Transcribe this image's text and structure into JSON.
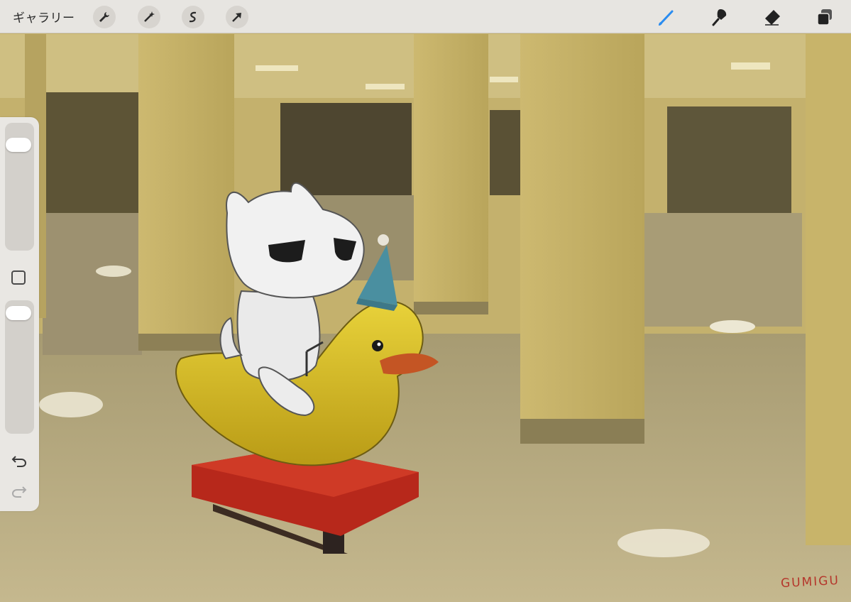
{
  "toolbar": {
    "gallery_label": "ギャラリー",
    "left_tools": [
      {
        "name": "actions",
        "icon": "wrench-icon"
      },
      {
        "name": "adjustments",
        "icon": "magic-wand-icon"
      },
      {
        "name": "selection",
        "icon": "selection-s-icon"
      },
      {
        "name": "transform",
        "icon": "arrow-cursor-icon"
      }
    ],
    "right_tools": [
      {
        "name": "brush",
        "icon": "brush-icon",
        "active": true
      },
      {
        "name": "smudge",
        "icon": "smudge-icon"
      },
      {
        "name": "eraser",
        "icon": "eraser-icon"
      },
      {
        "name": "layers",
        "icon": "layers-icon"
      }
    ],
    "active_color": "#2a8cf0"
  },
  "sidebar": {
    "brush_size_level": 0.87,
    "opacity_level": 0.95,
    "modify_icon": "square-icon",
    "undo_icon": "undo-icon",
    "redo_icon": "redo-icon"
  },
  "artwork": {
    "signature": "GUMIGU",
    "description_colors": {
      "wall": "#c9b56e",
      "floor": "#b3a57d",
      "duck": "#d9bf2a",
      "platform": "#b8291d",
      "hat": "#4a8fa0"
    }
  }
}
